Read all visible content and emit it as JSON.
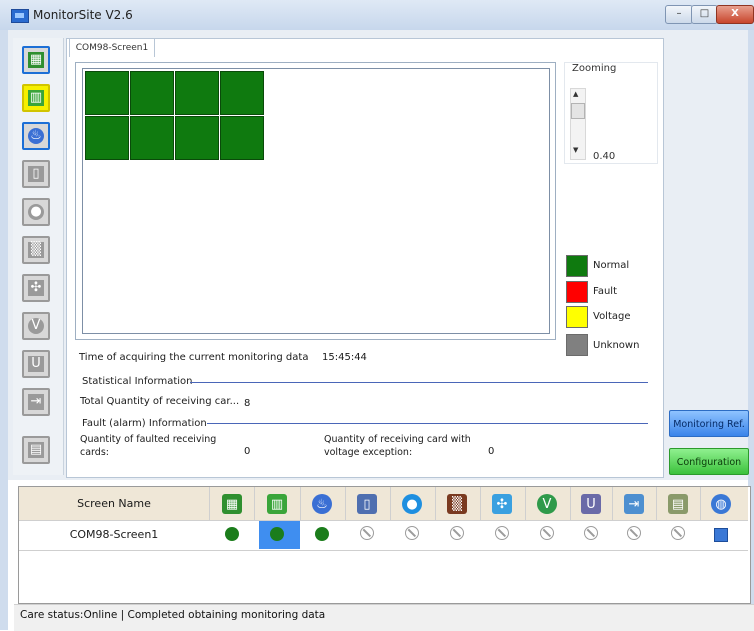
{
  "window": {
    "title": "MonitorSite V2.6",
    "controls": {
      "minimize": "–",
      "maximize": "□",
      "close": "X"
    }
  },
  "left_toolbar": {
    "items": [
      {
        "name": "receiving-card",
        "icon": "receiving-card-icon",
        "state": "active",
        "color": "#2f8f2f"
      },
      {
        "name": "screen-module",
        "icon": "module-icon",
        "state": "selected",
        "color": "#3aa53a"
      },
      {
        "name": "temperature",
        "icon": "thermometer-icon",
        "state": "active",
        "color": "#3a6fd4"
      },
      {
        "name": "door",
        "icon": "door-icon",
        "state": "disabled",
        "color": "#9a9a9a"
      },
      {
        "name": "humidity",
        "icon": "water-drop-icon",
        "state": "disabled",
        "color": "#9a9a9a"
      },
      {
        "name": "smoke",
        "icon": "smoke-icon",
        "state": "disabled",
        "color": "#9a9a9a"
      },
      {
        "name": "fan",
        "icon": "fan-icon",
        "state": "disabled",
        "color": "#9a9a9a"
      },
      {
        "name": "voltage",
        "icon": "voltage-icon",
        "state": "disabled",
        "color": "#9a9a9a"
      },
      {
        "name": "power-supply",
        "icon": "magnet-icon",
        "state": "disabled",
        "color": "#9a9a9a"
      },
      {
        "name": "flat-cable",
        "icon": "exit-icon",
        "state": "disabled",
        "color": "#9a9a9a"
      },
      {
        "name": "keyboard",
        "icon": "keyboard-icon",
        "state": "disabled",
        "color": "#9a9a9a"
      }
    ]
  },
  "tab": {
    "label": "COM98-Screen1"
  },
  "screen_grid": {
    "rows": 2,
    "cols": 4,
    "cell_color": "#0f7a0f"
  },
  "zoom": {
    "label": "Zooming",
    "value": "0.40"
  },
  "legend": [
    {
      "label": "Normal",
      "color": "#0f7a0f"
    },
    {
      "label": "Fault",
      "color": "#ff0000"
    },
    {
      "label": "Voltage",
      "color": "#ffff00"
    },
    {
      "label": "Unknown",
      "color": "#808080"
    }
  ],
  "acquire": {
    "label": "Time of acquiring the current monitoring data",
    "time": "15:45:44"
  },
  "statistical": {
    "title": "Statistical Information",
    "total_label": "Total Quantity of receiving car...",
    "total_value": "8"
  },
  "fault": {
    "title": "Fault (alarm) Information",
    "faulted_label_line1": "Quantity of faulted receiving",
    "faulted_label_line2": "cards:",
    "faulted_value": "0",
    "voltage_label_line1": "Quantity of receiving card with",
    "voltage_label_line2": "voltage exception:",
    "voltage_value": "0"
  },
  "buttons": {
    "monitoring": "Monitoring Ref.",
    "configuration": "Configuration"
  },
  "table": {
    "header_name": "Screen Name",
    "header_icons": [
      "receiving-card-icon",
      "module-icon",
      "thermometer-icon",
      "door-icon",
      "water-drop-icon",
      "smoke-icon",
      "fan-icon",
      "voltage-icon",
      "magnet-icon",
      "exit-icon",
      "keyboard-icon",
      "globe-icon"
    ],
    "rows": [
      {
        "name": "COM98-Screen1",
        "cells": [
          "ok",
          "ok",
          "ok",
          "na",
          "na",
          "na",
          "na",
          "na",
          "na",
          "na",
          "na",
          "info"
        ]
      }
    ]
  },
  "status": {
    "text": "Care status:Online  |  Completed obtaining monitoring data"
  }
}
